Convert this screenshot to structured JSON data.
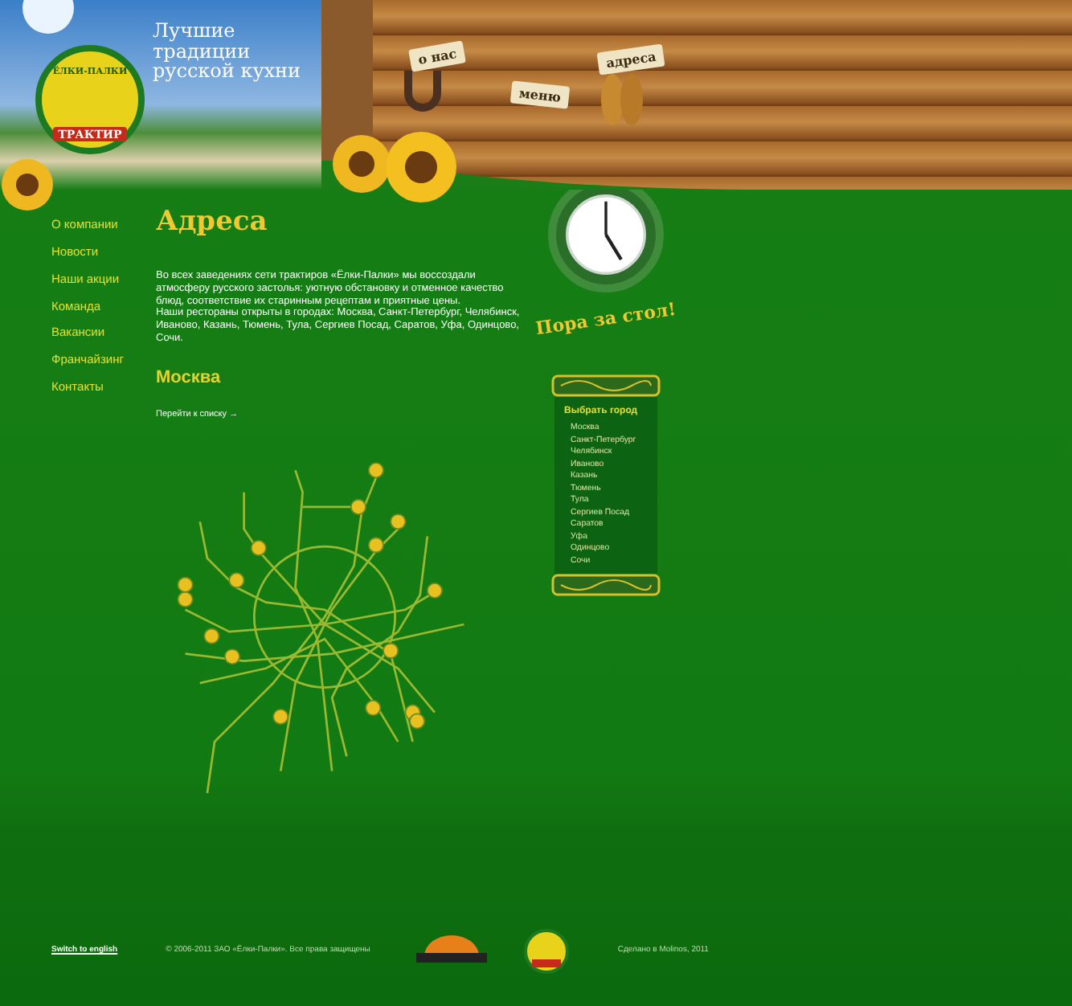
{
  "header": {
    "logo": {
      "title": "ЁЛКИ-ПАЛКИ",
      "subtitle": "ТРАКТИР"
    },
    "tagline": "Лучшие традиции русской кухни",
    "signs": [
      {
        "label": "о нас"
      },
      {
        "label": "меню"
      },
      {
        "label": "адреса"
      }
    ]
  },
  "sidebar": {
    "items": [
      "О компании",
      "Новости",
      "Наши акции",
      "Команда",
      "Вакансии",
      "Франчайзинг",
      "Контакты"
    ]
  },
  "content": {
    "title": "Адреса",
    "paragraphs": [
      "Во всех заведениях сети трактиров «Ёлки-Палки» мы воссоздали атмосферу русского застолья: уютную обстановку и отменное качество блюд, соответствие их старинным рецептам и приятные цены.",
      "Наши рестораны открыты в городах: Москва, Санкт-Петербург, Челябинск, Иваново, Казань, Тюмень, Тула, Сергиев Посад, Саратов, Уфа, Одинцово, Сочи."
    ],
    "city": "Москва",
    "list_link": "Перейти к списку →"
  },
  "clock": {
    "caption": "Пора за стол!"
  },
  "city_picker": {
    "title": "Выбрать город",
    "cities": [
      "Москва",
      "Санкт-Петербург",
      "Челябинск",
      "Иваново",
      "Казань",
      "Тюмень",
      "Тула",
      "Сергиев Посад",
      "Саратов",
      "Уфа",
      "Одинцово",
      "Сочи"
    ]
  },
  "footer": {
    "language_link": "Switch to english",
    "copyright": "© 2006-2011 ЗАО «Ёлки-Палки». Все права защищены",
    "credit": "Сделано в Molinos, 2011"
  }
}
